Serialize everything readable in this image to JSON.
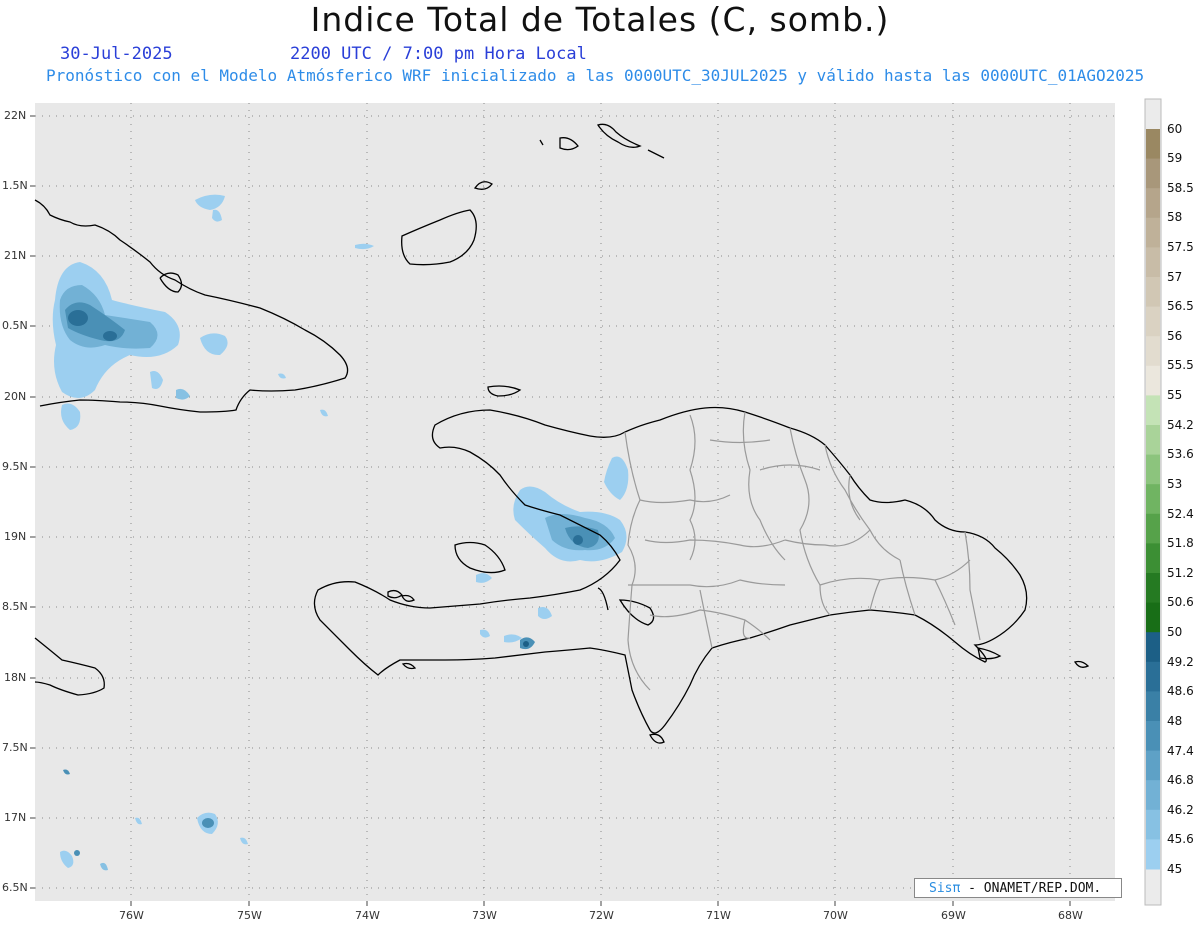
{
  "header": {
    "title": "Indice Total de Totales (C, somb.)",
    "date": "30-Jul-2025",
    "time": "2200 UTC / 7:00 pm Hora Local",
    "forecast": "Pronóstico con el Modelo Atmósferico WRF inicializado a las 0000UTC_30JUL2025 y válido hasta las  0000UTC_01AGO2025"
  },
  "map": {
    "lat_labels": [
      "22N",
      "1.5N",
      "21N",
      "0.5N",
      "20N",
      "9.5N",
      "19N",
      "8.5N",
      "18N",
      "7.5N",
      "17N",
      "6.5N"
    ],
    "lon_labels": [
      "76W",
      "75W",
      "74W",
      "73W",
      "72W",
      "71W",
      "70W",
      "69W",
      "68W"
    ],
    "background_color": "#e8e8e8",
    "coastline_color": "#000000",
    "border_color": "#9a9a9a"
  },
  "colorbar": {
    "labels": [
      "60",
      "59",
      "58.5",
      "58",
      "57.5",
      "57",
      "56.5",
      "56",
      "55.5",
      "55",
      "54.2",
      "53.6",
      "53",
      "52.4",
      "51.8",
      "51.2",
      "50.6",
      "50",
      "49.2",
      "48.6",
      "48",
      "47.4",
      "46.8",
      "46.2",
      "45.6",
      "45"
    ],
    "colors": [
      "#9a8862",
      "#a8977a",
      "#b5a58b",
      "#bfb199",
      "#c8bca7",
      "#d1c7b4",
      "#dad2c2",
      "#e2dccf",
      "#ebe7dd",
      "#c4e3b6",
      "#a9d399",
      "#8cc47d",
      "#70b462",
      "#56a24a",
      "#3c8f34",
      "#257a22",
      "#186e17",
      "#1c5f86",
      "#2a6f97",
      "#3a80a6",
      "#4a90b6",
      "#5ea1c6",
      "#72b1d5",
      "#87c1e3",
      "#9ccff0"
    ]
  },
  "credit": {
    "sis": "Sisπ",
    "org": "- ONAMET/REP.DOM."
  }
}
